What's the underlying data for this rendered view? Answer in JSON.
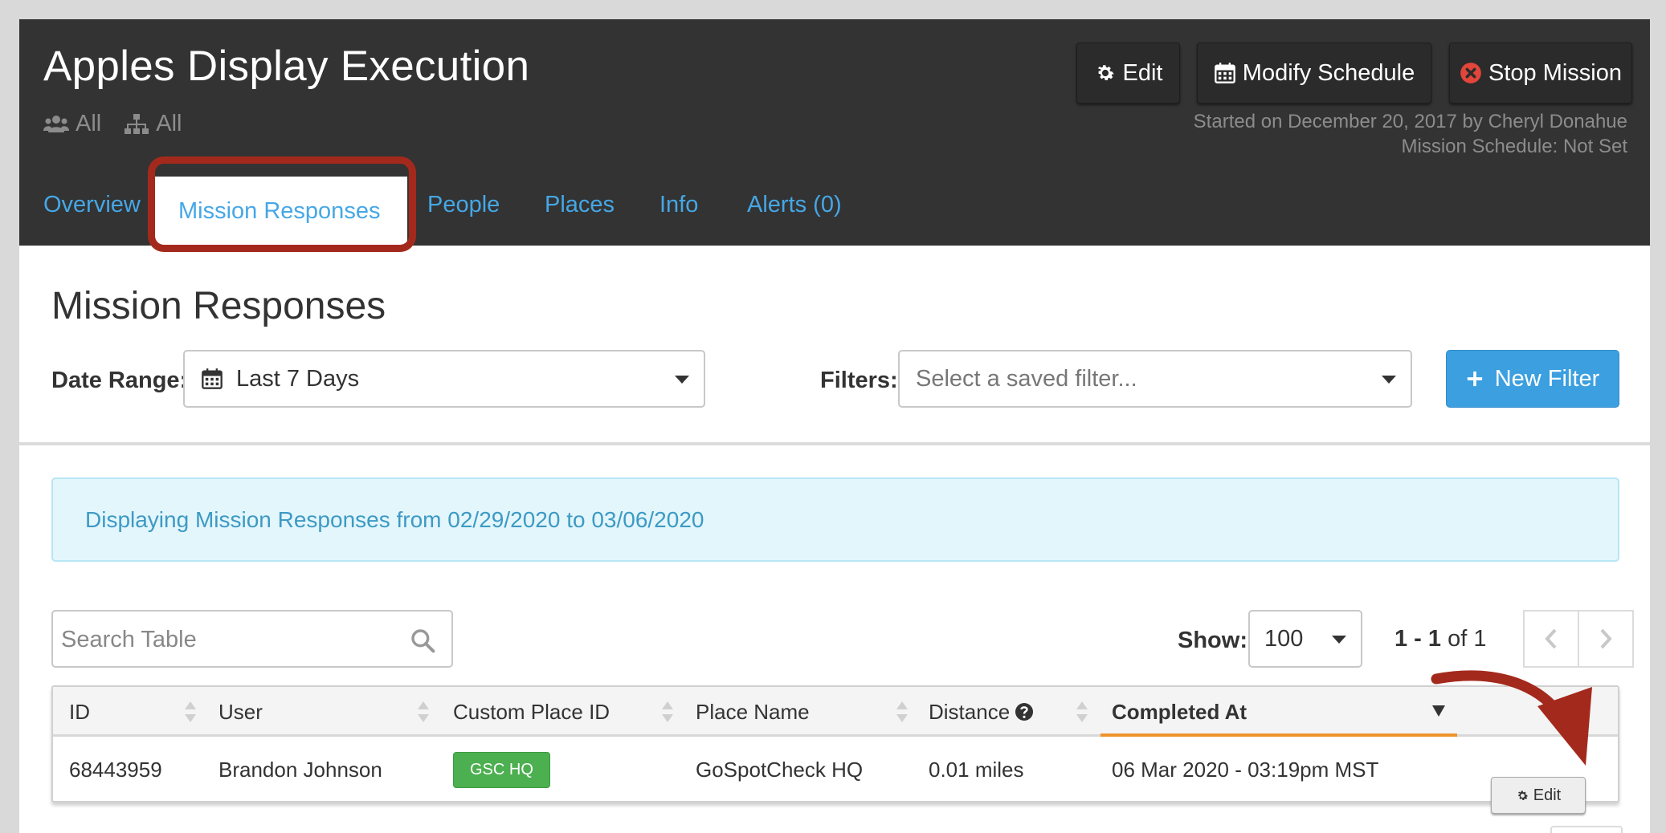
{
  "header": {
    "title": "Apples Display Execution",
    "scope_groups": "All",
    "scope_hierarchy": "All",
    "buttons": {
      "edit": "Edit",
      "modify_schedule": "Modify Schedule",
      "stop_mission": "Stop Mission"
    },
    "started_on": "Started on December 20, 2017 by Cheryl Donahue",
    "schedule": "Mission Schedule: Not Set"
  },
  "tabs": [
    {
      "label": "Overview",
      "active": false
    },
    {
      "label": "Mission Responses",
      "active": true
    },
    {
      "label": "People",
      "active": false
    },
    {
      "label": "Places",
      "active": false
    },
    {
      "label": "Info",
      "active": false
    },
    {
      "label": "Alerts (0)",
      "active": false
    }
  ],
  "section": {
    "title": "Mission Responses",
    "date_range_label": "Date Range:",
    "date_range_value": "Last 7 Days",
    "filters_label": "Filters:",
    "filters_placeholder": "Select a saved filter...",
    "new_filter_label": "New Filter"
  },
  "banner": {
    "text": "Displaying Mission Responses from 02/29/2020 to 03/06/2020"
  },
  "table_controls": {
    "search_placeholder": "Search Table",
    "show_label": "Show:",
    "page_size": "100",
    "range_text": "1 - 1",
    "of_text": "of 1"
  },
  "table": {
    "columns": [
      "ID",
      "User",
      "Custom Place ID",
      "Place Name",
      "Distance",
      "Completed At"
    ],
    "sorted_column": "Completed At",
    "rows": [
      {
        "id": "68443959",
        "user": "Brandon Johnson",
        "custom_place_id": "GSC HQ",
        "place_name": "GoSpotCheck HQ",
        "distance": "0.01 miles",
        "completed_at": "06 Mar 2020 - 03:19pm MST",
        "action": "Edit"
      }
    ]
  },
  "colors": {
    "header_bg": "#333333",
    "tab_link": "#45a7e6",
    "highlight": "#a4291d",
    "primary_button": "#3b9fe0",
    "badge_green": "#4caf50",
    "sort_underline": "#f0932a",
    "banner_bg": "#e3f6fc",
    "banner_text": "#3d9ac4"
  },
  "icons": [
    "users-icon",
    "hierarchy-icon",
    "gear-icon",
    "calendar-icon",
    "stop-circle-icon",
    "plus-icon",
    "search-icon",
    "chevron-left-icon",
    "chevron-right-icon",
    "question-circle-icon",
    "sort-icon",
    "sort-desc-icon",
    "annotation-arrow-icon"
  ]
}
